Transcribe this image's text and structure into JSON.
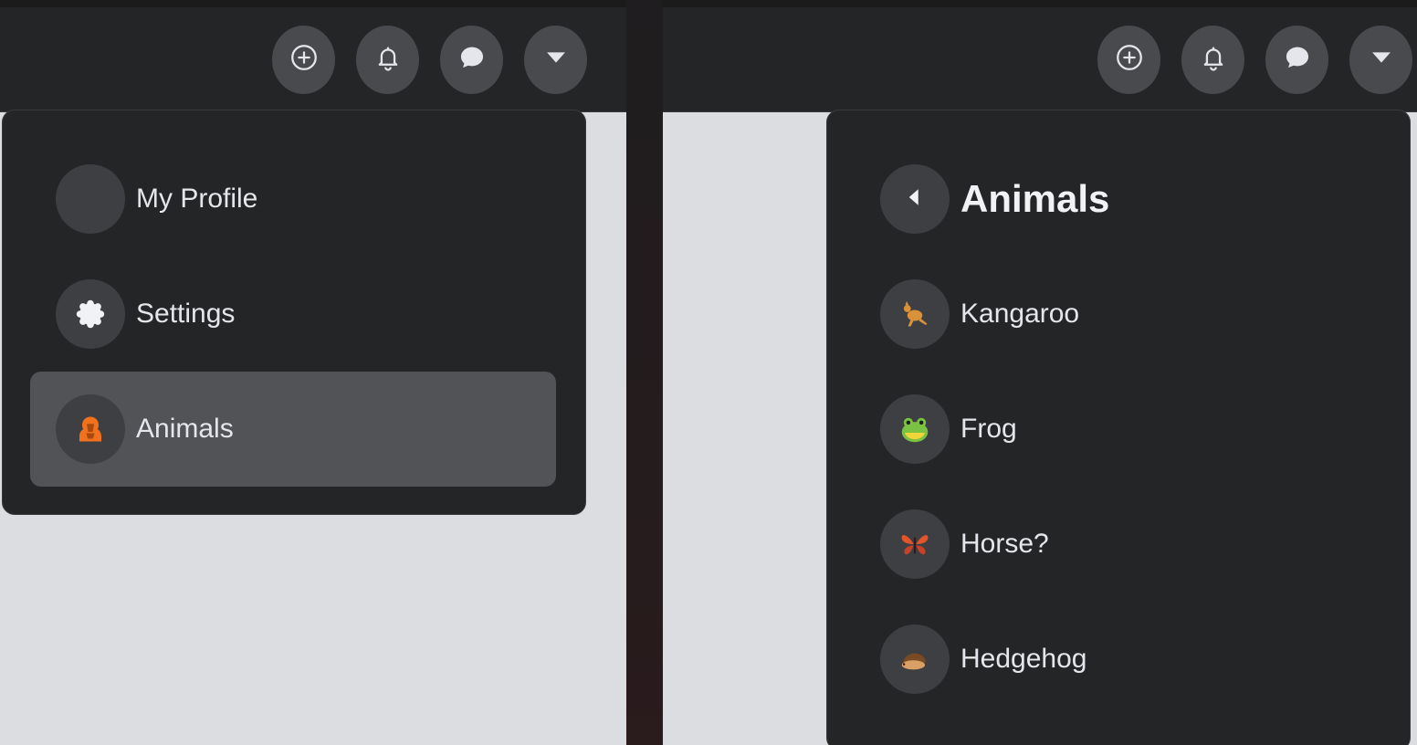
{
  "left": {
    "menu": {
      "items": [
        {
          "label": "My Profile",
          "icon": "profile-avatar-icon"
        },
        {
          "label": "Settings",
          "icon": "gear-icon"
        },
        {
          "label": "Animals",
          "icon": "animal-icon"
        }
      ]
    }
  },
  "right": {
    "submenu": {
      "title": "Animals",
      "back_icon": "back-arrow-icon",
      "items": [
        {
          "label": "Kangaroo",
          "icon": "kangaroo-icon"
        },
        {
          "label": "Frog",
          "icon": "frog-icon"
        },
        {
          "label": "Horse?",
          "icon": "butterfly-icon"
        },
        {
          "label": "Hedgehog",
          "icon": "hedgehog-icon"
        }
      ]
    }
  },
  "navbar": {
    "icons": [
      "plus-circle-icon",
      "bell-icon",
      "chat-bubble-icon",
      "caret-down-icon"
    ]
  },
  "colors": {
    "navbar_bg": "#242526",
    "dropdown_bg": "#242526",
    "nav_button_bg": "#484a4d",
    "active_item_bg": "#525357",
    "text": "#e4e6eb",
    "page_bg": "#dcdde1"
  }
}
